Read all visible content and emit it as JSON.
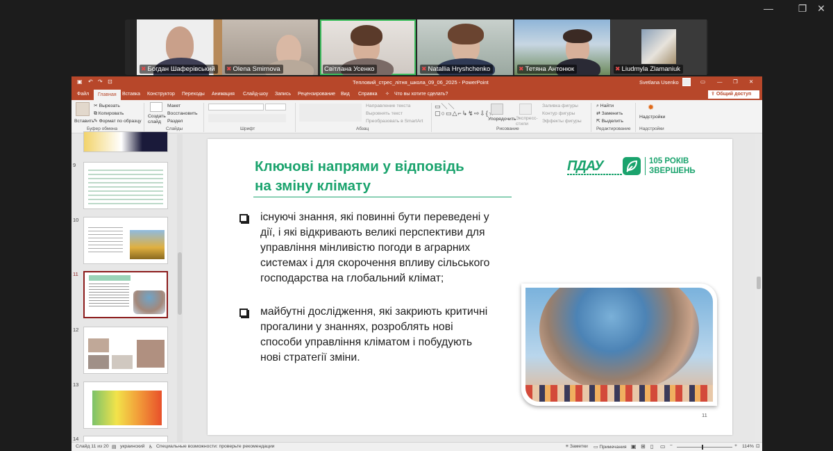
{
  "window_controls": {
    "minimize": "—",
    "maximize": "❐",
    "close": "✕"
  },
  "participants": [
    {
      "name": "Богдан Шаферівський",
      "muted": true
    },
    {
      "name": "Olena Smirnova",
      "muted": true
    },
    {
      "name": "Світлана Усенко",
      "muted": false,
      "active": true
    },
    {
      "name": "Natallia Hryshchenko",
      "muted": true
    },
    {
      "name": "Тетяна Антонюк",
      "muted": true
    },
    {
      "name": "Liudmyla Zlamaniuk",
      "muted": true
    }
  ],
  "ppt": {
    "title": "Тепловий_стрес_літня_школа_09_06_2025  -  PowerPoint",
    "user": "Svetlana Usenko",
    "share": "Общий доступ",
    "tabs": [
      "Файл",
      "Главная",
      "Вставка",
      "Конструктор",
      "Переходы",
      "Анимация",
      "Слайд-шоу",
      "Запись",
      "Рецензирование",
      "Вид",
      "Справка"
    ],
    "tell_me": "Что вы хотите сделать?",
    "ribbon": {
      "paste": "Вставить",
      "cut": "Вырезать",
      "copy": "Копировать",
      "format_painter": "Формат по образцу",
      "clipboard_group": "Буфер обмена",
      "new_slide": "Создать слайд",
      "layout": "Макет",
      "reset": "Восстановить",
      "section": "Раздел",
      "slides_group": "Слайды",
      "font_group": "Шрифт",
      "text_direction": "Направление текста",
      "align_text": "Выровнять текст",
      "smartart": "Преобразовать в SmartArt",
      "paragraph_group": "Абзац",
      "arrange": "Упорядочить",
      "quick_styles": "Экспресс-стили",
      "shape_fill": "Заливка фигуры",
      "shape_outline": "Контур фигуры",
      "shape_effects": "Эффекты фигуры",
      "drawing_group": "Рисование",
      "find": "Найти",
      "replace": "Заменить",
      "select": "Выделить",
      "editing_group": "Редактирование",
      "addins": "Надстройки",
      "addins_group": "Надстройки"
    },
    "thumbnails": [
      {
        "num": "9"
      },
      {
        "num": "10"
      },
      {
        "num": "11",
        "selected": true
      },
      {
        "num": "12"
      },
      {
        "num": "13"
      },
      {
        "num": "14"
      }
    ],
    "slide": {
      "title_line1": "Ключові напрями у відповідь",
      "title_line2": "на зміну клімату",
      "logo_text": "ПДАУ",
      "logo_years": "105 РОКІВ",
      "logo_sub": "ЗВЕРШЕНЬ",
      "bullet1": [
        "існуючі знання, які повинні бути переведені у",
        "дії, і які відкривають великі перспективи для",
        "управління мінливістю погоди в аграрних",
        "системах і для скорочення впливу сільського",
        "господарства на глобальний клімат;"
      ],
      "bullet2": [
        "майбутні дослідження, які закриють критичні",
        "прогалини у знаннях, розроблять нові",
        "способи управління кліматом і побудують",
        "нові стратегії зміни."
      ],
      "page_number": "11"
    },
    "status": {
      "slide_counter": "Слайд 11 из 20",
      "language": "украинский",
      "accessibility": "Специальные возможности: проверьте рекомендации",
      "notes": "Заметки",
      "comments": "Примечания",
      "zoom": "114%"
    },
    "colors": {
      "brand": "#b7472a",
      "accent_green": "#1aa36d"
    }
  }
}
